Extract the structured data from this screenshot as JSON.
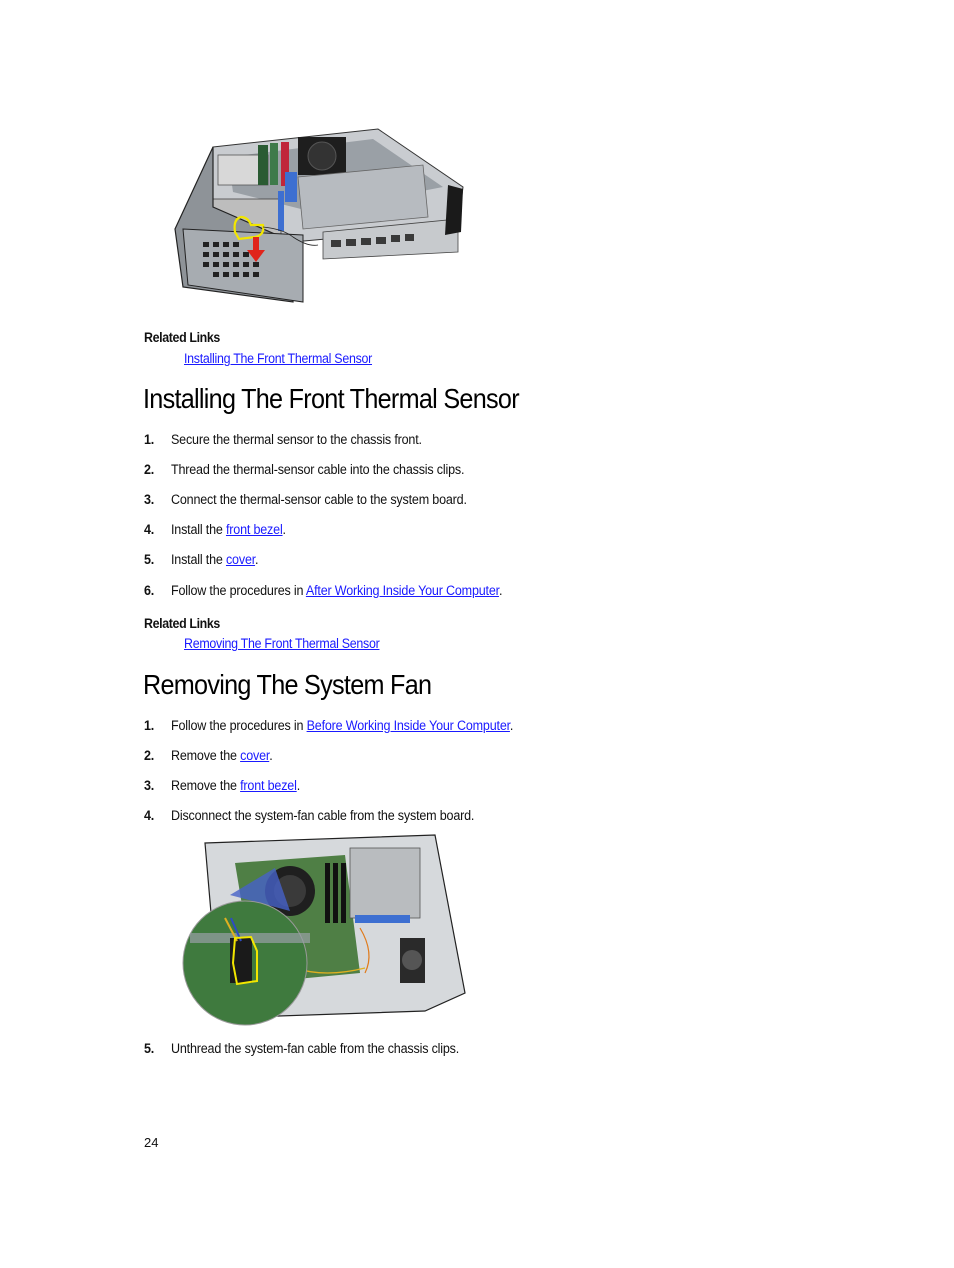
{
  "section_1": {
    "figure_alt": "Chassis front with thermal sensor highlighted and red removal arrow",
    "related_links_title": "Related Links",
    "related_link": "Installing The Front Thermal Sensor"
  },
  "section_2": {
    "title": "Installing The Front Thermal Sensor",
    "steps": [
      {
        "num": "1.",
        "pre": "Secure the thermal sensor to the chassis front.",
        "link": "",
        "post": ""
      },
      {
        "num": "2.",
        "pre": "Thread the thermal-sensor cable into the chassis clips.",
        "link": "",
        "post": ""
      },
      {
        "num": "3.",
        "pre": "Connect the thermal-sensor cable to the system board.",
        "link": "",
        "post": ""
      },
      {
        "num": "4.",
        "pre": "Install the ",
        "link": "front bezel",
        "post": "."
      },
      {
        "num": "5.",
        "pre": "Install the ",
        "link": "cover",
        "post": "."
      },
      {
        "num": "6.",
        "pre": "Follow the procedures in ",
        "link": "After Working Inside Your Computer",
        "post": "."
      }
    ],
    "related_links_title": "Related Links",
    "related_link": "Removing The Front Thermal Sensor"
  },
  "section_3": {
    "title": "Removing The System Fan",
    "steps": [
      {
        "num": "1.",
        "pre": "Follow the procedures in ",
        "link": "Before Working Inside Your Computer",
        "post": "."
      },
      {
        "num": "2.",
        "pre": "Remove the ",
        "link": "cover",
        "post": "."
      },
      {
        "num": "3.",
        "pre": "Remove the ",
        "link": "front bezel",
        "post": "."
      },
      {
        "num": "4.",
        "pre": "Disconnect the system-fan cable from the system board.",
        "link": "",
        "post": ""
      },
      {
        "num": "5.",
        "pre": "Unthread the system-fan cable from the chassis clips.",
        "link": "",
        "post": ""
      }
    ],
    "figure_alt": "System board with system-fan cable connector highlighted in magnified callout"
  },
  "footer": {
    "page_number": "24"
  },
  "colors": {
    "link": "#1a1aff",
    "highlight": "#f2e600",
    "arrow": "#e0241b"
  }
}
